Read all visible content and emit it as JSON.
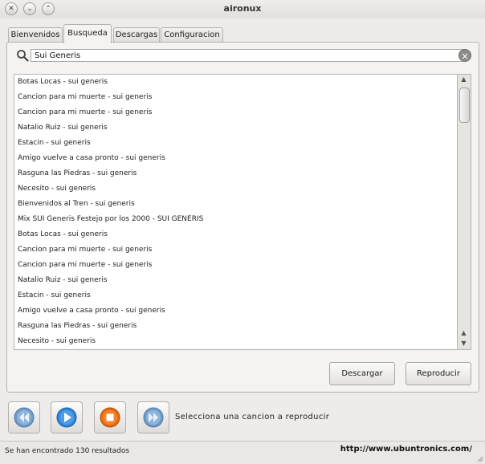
{
  "window": {
    "title": "aironux"
  },
  "tabs": [
    {
      "label": "Bienvenidos"
    },
    {
      "label": "Busqueda"
    },
    {
      "label": "Descargas"
    },
    {
      "label": "Configuracion"
    }
  ],
  "search": {
    "value": "Sui Generis"
  },
  "results": [
    "Botas Locas - sui generis",
    "Cancion para mi muerte - sui generis",
    "Cancion para mi muerte - sui generis",
    "Natalio Ruiz - sui generis",
    "Estacin - sui generis",
    "Amigo vuelve a casa pronto - sui generis",
    "Rasguna las Piedras - sui generis",
    "Necesito - sui generis",
    "Bienvenidos al Tren - sui generis",
    "Mix SUI Generis Festejo por los 2000 - SUI GENERIS",
    "Botas Locas - sui generis",
    "Cancion para mi muerte - sui generis",
    "Cancion para mi muerte - sui generis",
    "Natalio Ruiz - sui generis",
    "Estacin - sui generis",
    "Amigo vuelve a casa pronto - sui generis",
    "Rasguna las Piedras - sui generis",
    "Necesito - sui generis"
  ],
  "buttons": {
    "download": "Descargar",
    "play": "Reproducir"
  },
  "player": {
    "message": "Selecciona una cancion a reproducir"
  },
  "status": {
    "text": "Se han encontrado 130 resultados",
    "url": "http://www.ubuntronics.com/"
  },
  "icons": {
    "close": "close-icon",
    "minimize": "minimize-icon",
    "maximize": "maximize-icon",
    "search": "search-icon",
    "clear": "clear-icon",
    "rewind": "rewind-icon",
    "play": "play-icon",
    "stop": "stop-icon",
    "forward": "fast-forward-icon"
  },
  "colors": {
    "play_blue": "#2f84d8",
    "stop_orange": "#e86a10",
    "media_gray": "#6f9bc8"
  }
}
